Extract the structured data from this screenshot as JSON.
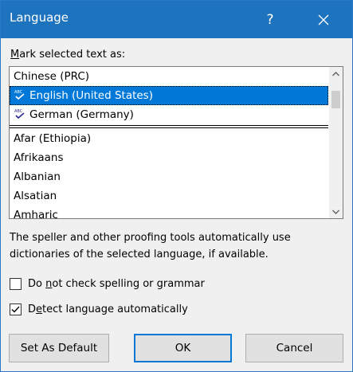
{
  "window": {
    "title": "Language",
    "help_label": "?"
  },
  "prompt": {
    "pre": "",
    "accel": "M",
    "post": "ark selected text as:"
  },
  "languages": {
    "recent": [
      {
        "label": "Chinese (PRC)",
        "proofing": false,
        "selected": false
      },
      {
        "label": "English (United States)",
        "proofing": true,
        "selected": true
      },
      {
        "label": "German (Germany)",
        "proofing": true,
        "selected": false
      }
    ],
    "all": [
      {
        "label": "Afar (Ethiopia)"
      },
      {
        "label": "Afrikaans"
      },
      {
        "label": "Albanian"
      },
      {
        "label": "Alsatian"
      },
      {
        "label": "Amharic"
      }
    ]
  },
  "info_text": "The speller and other proofing tools automatically use dictionaries of the selected language, if available.",
  "options": {
    "no_check": {
      "pre": "Do ",
      "accel": "n",
      "post": "ot check spelling or grammar",
      "checked": false
    },
    "detect": {
      "pre": "D",
      "accel": "e",
      "post": "tect language automatically",
      "checked": true
    }
  },
  "buttons": {
    "set_default": "Set As Default",
    "ok": "OK",
    "cancel": "Cancel"
  },
  "colors": {
    "titlebar": "#1e73be",
    "selection": "#0078d7",
    "spell_icon": "#2b2b8f"
  }
}
